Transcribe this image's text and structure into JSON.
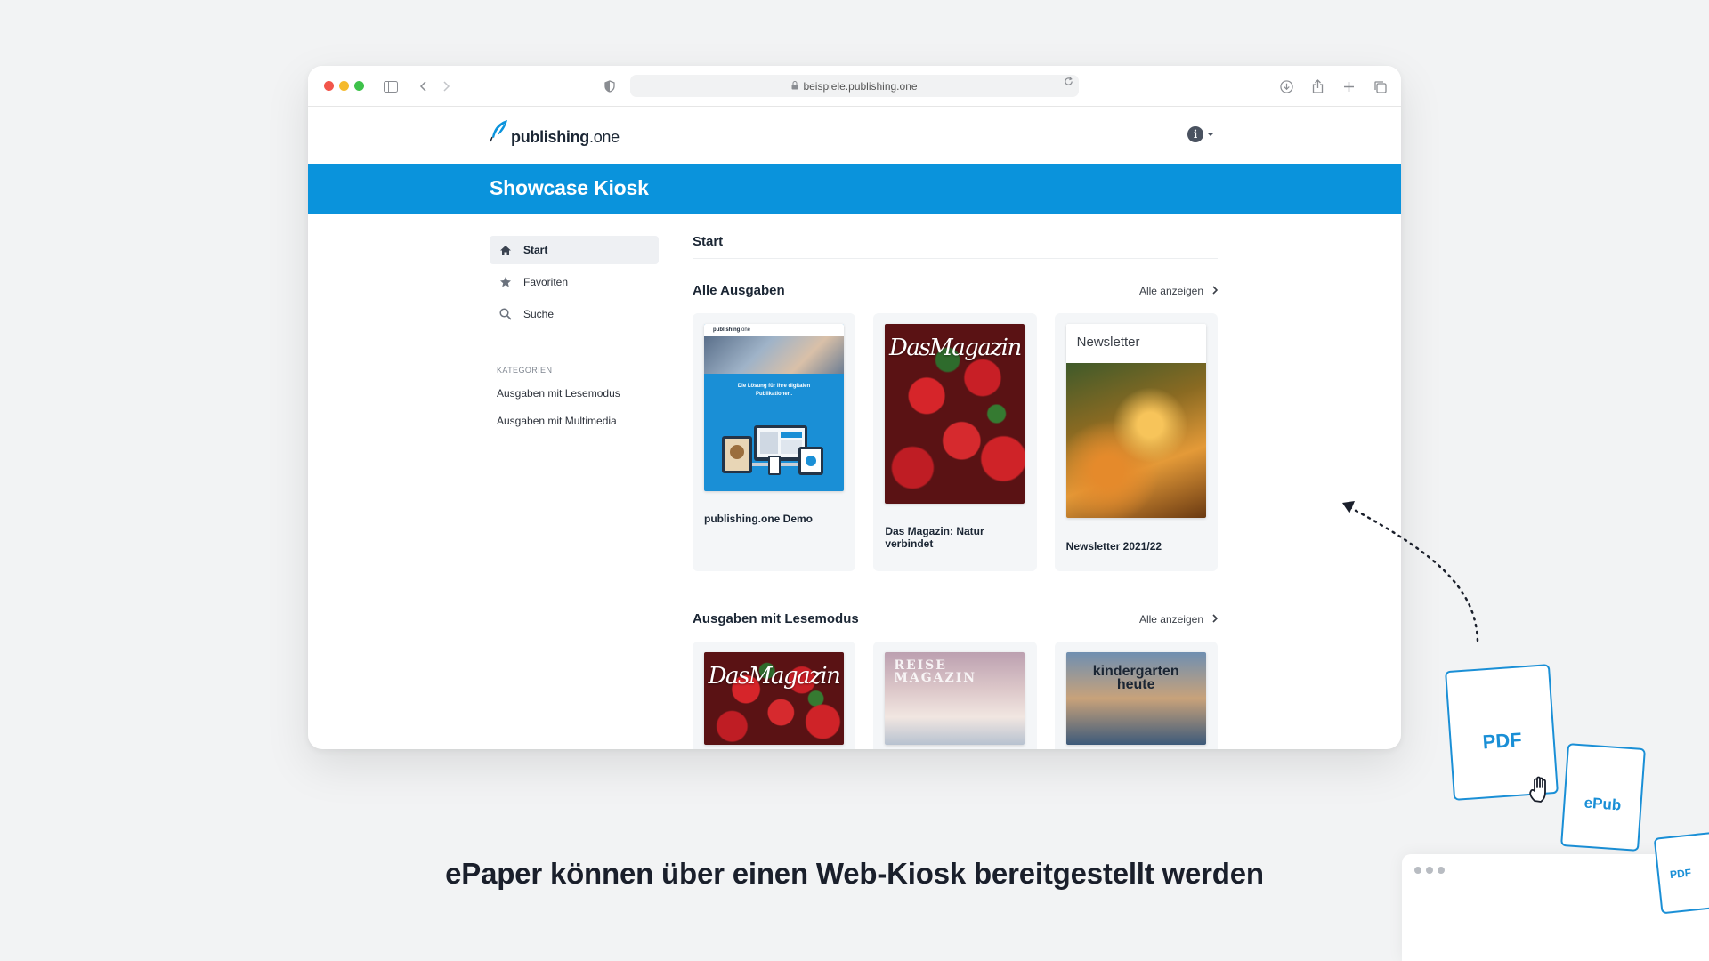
{
  "browser": {
    "url": "beispiele.publishing.one"
  },
  "brand": {
    "logo_bold": "publishing",
    "logo_light": ".one",
    "banner_title": "Showcase Kiosk"
  },
  "colors": {
    "accent": "#0a93dc",
    "doc_blue": "#1a8fd6"
  },
  "sidebar": {
    "nav": [
      {
        "label": "Start",
        "icon": "home-icon"
      },
      {
        "label": "Favoriten",
        "icon": "star-icon"
      },
      {
        "label": "Suche",
        "icon": "search-icon"
      }
    ],
    "categories_title": "KATEGORIEN",
    "categories": [
      "Ausgaben mit Lesemodus",
      "Ausgaben mit Multimedia"
    ]
  },
  "main": {
    "title": "Start",
    "sections": [
      {
        "title": "Alle Ausgaben",
        "show_all": "Alle anzeigen",
        "items": [
          {
            "title": "publishing.one Demo",
            "cover_tagline": "Die Lösung für Ihre digitalen Publikationen."
          },
          {
            "title": "Das Magazin: Natur verbindet",
            "cover_masthead": "DasMagazin"
          },
          {
            "title": "Newsletter 2021/22",
            "cover_masthead": "Newsletter"
          }
        ]
      },
      {
        "title": "Ausgaben mit Lesemodus",
        "show_all": "Alle anzeigen",
        "items": [
          {
            "cover_masthead": "DasMagazin"
          },
          {
            "cover_masthead": "REISE MAGAZIN"
          },
          {
            "cover_masthead": "kindergarten heute"
          }
        ]
      }
    ]
  },
  "caption": "ePaper können über einen Web-Kiosk bereitgestellt werden",
  "docs": {
    "pdf": "PDF",
    "epub": "ePub",
    "pdf_small": "PDF"
  }
}
